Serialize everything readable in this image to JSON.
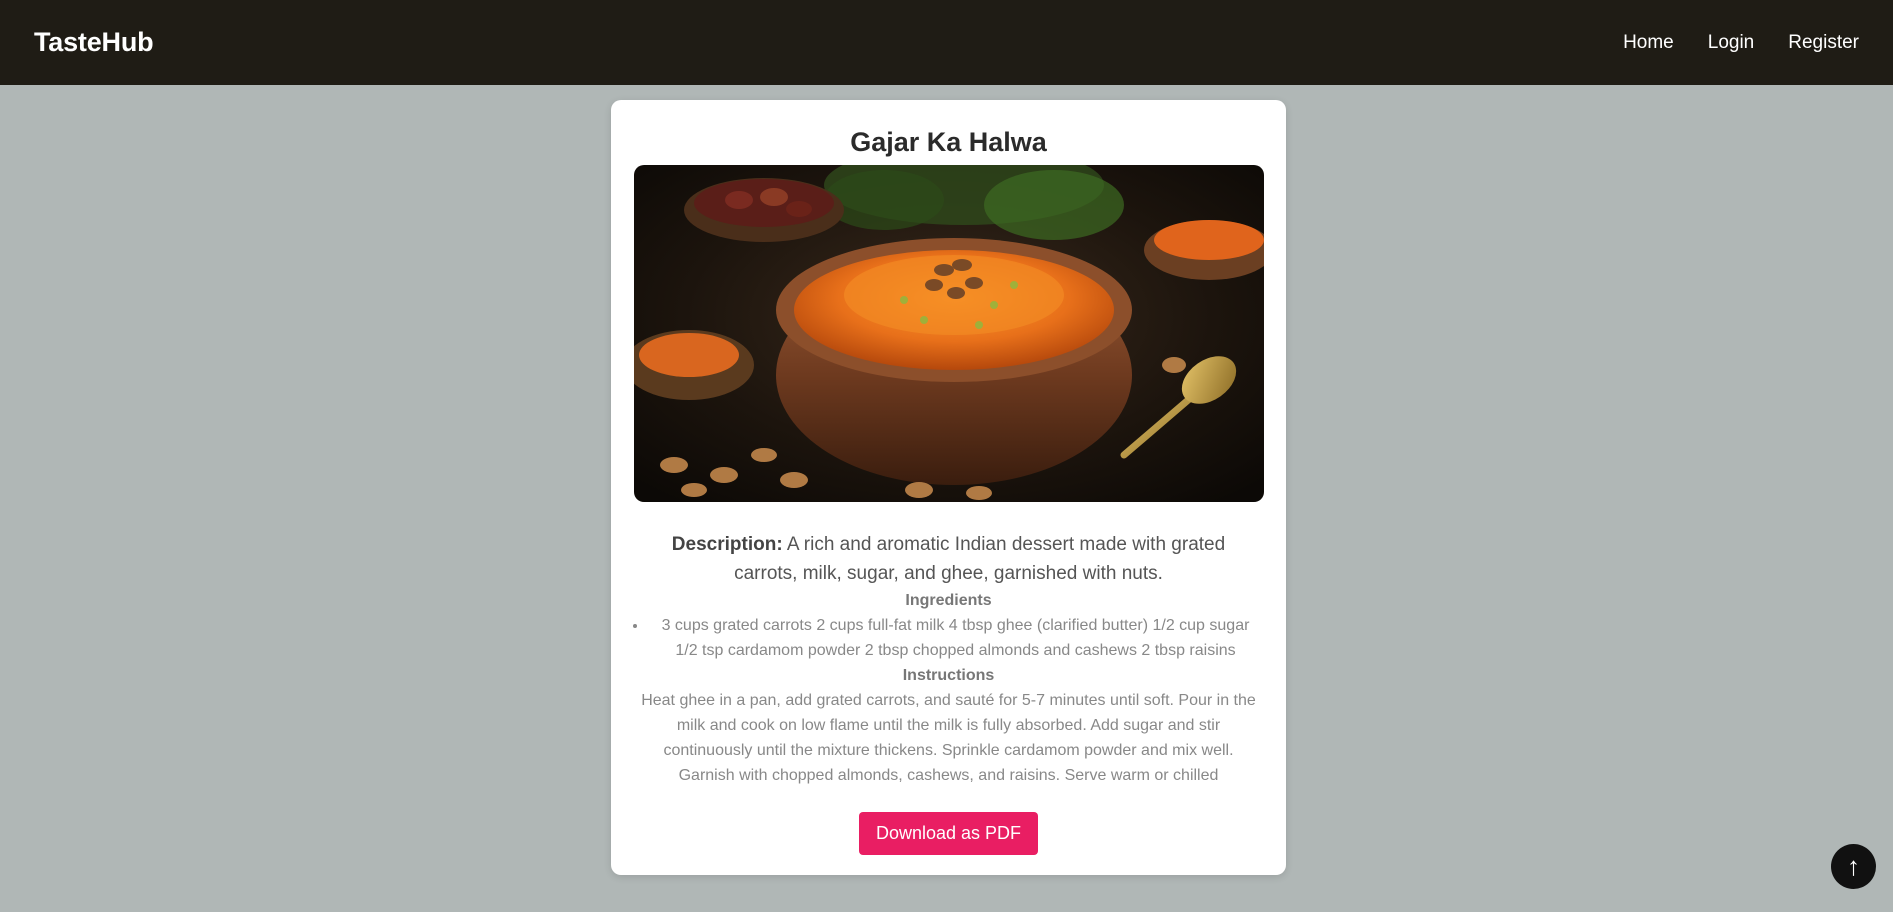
{
  "header": {
    "brand": "TasteHub",
    "nav": [
      {
        "label": "Home"
      },
      {
        "label": "Login"
      },
      {
        "label": "Register"
      }
    ]
  },
  "recipe": {
    "title": "Gajar Ka Halwa",
    "image_alt": "Gajar Ka Halwa",
    "description_label": "Description:",
    "description": " A rich and aromatic Indian dessert made with grated carrots, milk, sugar, and ghee, garnished with nuts.",
    "ingredients_heading": "Ingredients",
    "ingredients": "3 cups grated carrots 2 cups full-fat milk 4 tbsp ghee (clarified butter) 1/2 cup sugar 1/2 tsp cardamom powder 2 tbsp chopped almonds and cashews 2 tbsp raisins",
    "instructions_heading": "Instructions",
    "instructions": "Heat ghee in a pan, add grated carrots, and sauté for 5-7 minutes until soft. Pour in the milk and cook on low flame until the milk is fully absorbed. Add sugar and stir continuously until the mixture thickens. Sprinkle cardamom powder and mix well. Garnish with chopped almonds, cashews, and raisins. Serve warm or chilled",
    "download_label": "Download as PDF"
  },
  "scroll_top": {
    "icon": "arrow-up-icon",
    "glyph": "↑"
  },
  "colors": {
    "navbar": "#1f1c15",
    "page_bg": "#b0b7b6",
    "button": "#e91e63"
  }
}
